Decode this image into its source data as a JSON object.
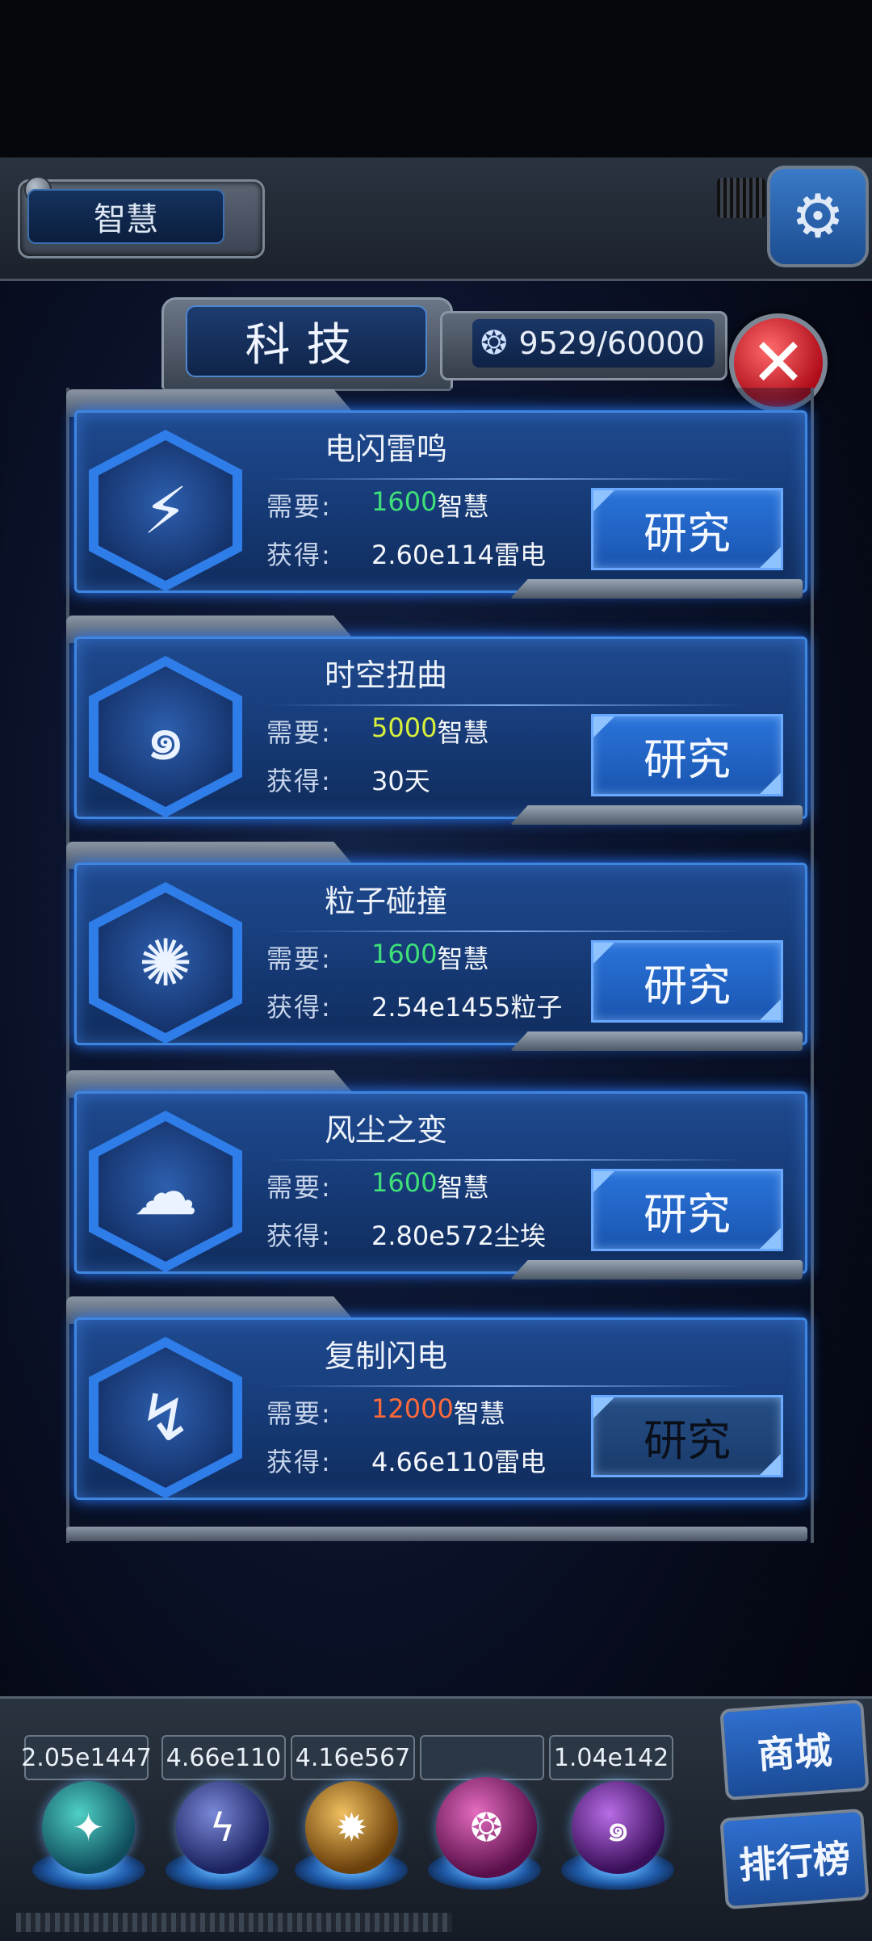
{
  "header": {
    "resource_tab": "智慧",
    "settings_icon": "gear-icon"
  },
  "panel": {
    "title": "科技",
    "wisdom_counter": "9529/60000",
    "brain_icon": "brain-icon",
    "close_icon": "close-x-icon"
  },
  "labels": {
    "need": "需要:",
    "gain": "获得:",
    "research": "研究"
  },
  "colors": {
    "cost_affordable": "#3fe07a",
    "cost_warning": "#d8f03c",
    "cost_unaffordable": "#ff6a3a",
    "card_blue": "#1f4a8f",
    "accent_glow": "#3f86e0"
  },
  "techs": [
    {
      "name": "电闪雷鸣",
      "cost_value": "1600",
      "cost_unit": "智慧",
      "gain": "2.60e114雷电",
      "icon": "lightning-strike-icon",
      "cost_state": "affordable",
      "research_enabled": true
    },
    {
      "name": "时空扭曲",
      "cost_value": "5000",
      "cost_unit": "智慧",
      "gain": "30天",
      "icon": "vortex-icon",
      "cost_state": "warning",
      "research_enabled": true
    },
    {
      "name": "粒子碰撞",
      "cost_value": "1600",
      "cost_unit": "智慧",
      "gain": "2.54e1455粒子",
      "icon": "particle-collision-icon",
      "cost_state": "affordable",
      "research_enabled": true
    },
    {
      "name": "风尘之变",
      "cost_value": "1600",
      "cost_unit": "智慧",
      "gain": "2.80e572尘埃",
      "icon": "dust-storm-icon",
      "cost_state": "affordable",
      "research_enabled": true
    },
    {
      "name": "复制闪电",
      "cost_value": "12000",
      "cost_unit": "智慧",
      "gain": "4.66e110雷电",
      "icon": "copy-lightning-icon",
      "cost_state": "unaffordable",
      "research_enabled": false
    }
  ],
  "bottom_bar": {
    "resources": [
      "2.05e1447",
      "4.66e110",
      "4.16e567",
      "",
      "1.04e142"
    ],
    "orbs": [
      "particle-orb-icon",
      "lightning-orb-icon",
      "dust-orb-icon",
      "brain-orb-icon",
      "vortex-orb-icon"
    ],
    "shop": "商城",
    "leaderboard": "排行榜"
  }
}
